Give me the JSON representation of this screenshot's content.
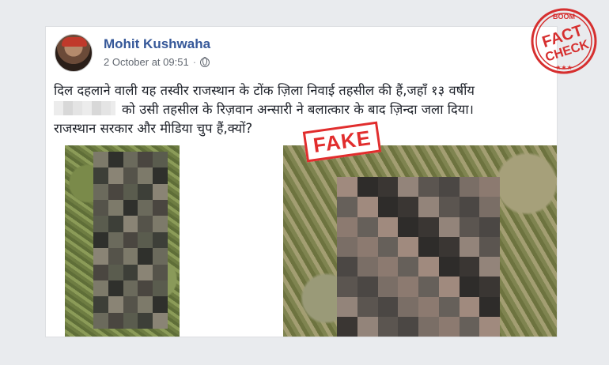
{
  "post": {
    "author": "Mohit Kushwaha",
    "timestamp": "2 October at 09:51",
    "separator": "·",
    "text_line1": "दिल दहलाने वाली यह तस्वीर राजस्थान के टोंक ज़िला निवाई तहसील की हैं,जहाँ १३ वर्षीय",
    "text_line2": "को उसी तहसील के रिज़वान अन्सारी ने बलात्कार के बाद ज़िन्दा जला दिया।",
    "text_line3": "राजस्थान सरकार और मीडिया चुप हैं,क्यों?"
  },
  "stamp": {
    "label": "FAKE",
    "color": "#e12d2d"
  },
  "logo": {
    "brand": "BOOM",
    "line1": "FACT",
    "line2": "CHECK",
    "color": "#d62f2f"
  },
  "icons": [
    "avatar",
    "globe-icon",
    "fake-stamp",
    "fact-check-logo"
  ],
  "colors": {
    "author": "#365899",
    "meta": "#616770",
    "text": "#1d2129",
    "background": "#e9ebee"
  }
}
